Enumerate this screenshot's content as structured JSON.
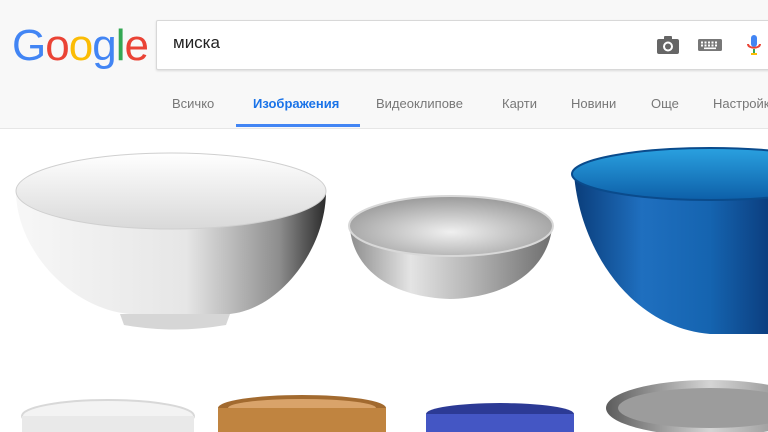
{
  "logo": {
    "letters": [
      "G",
      "o",
      "o",
      "g",
      "l",
      "e"
    ],
    "colors": [
      "#4285F4",
      "#EA4335",
      "#FBBC05",
      "#4285F4",
      "#34A853",
      "#EA4335"
    ]
  },
  "search": {
    "value": "миска",
    "icons": [
      "camera-icon",
      "keyboard-icon",
      "microphone-icon"
    ]
  },
  "tabs": [
    "Всичко",
    "Изображения",
    "Видеоклипове",
    "Карти",
    "Новини",
    "Още",
    "Настройки"
  ],
  "active_tab": "Изображения",
  "results": [
    {
      "name": "white-ceramic-bowl",
      "color": "#ffffff"
    },
    {
      "name": "steel-bowl",
      "color": "#c8c8c8"
    },
    {
      "name": "blue-glass-bowl",
      "color": "#1e6fb5"
    },
    {
      "name": "white-bowl-small",
      "color": "#f2f2f2"
    },
    {
      "name": "wooden-bowl",
      "color": "#c9965a"
    },
    {
      "name": "blue-bowl",
      "color": "#3b4db8"
    },
    {
      "name": "steel-bowl-large",
      "color": "#a9a9a9"
    }
  ]
}
